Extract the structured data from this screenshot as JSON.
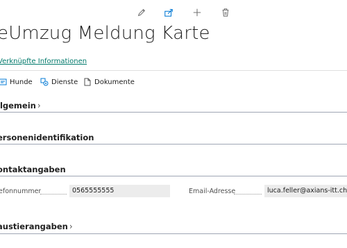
{
  "toolbar": {
    "edit_icon": "pencil-icon",
    "share_icon": "share-icon",
    "new_icon": "plus-icon",
    "delete_icon": "trash-icon"
  },
  "page": {
    "title": "eUmzug Meldung Karte",
    "related_link": "Verknüpfte Informationen"
  },
  "actions": [
    {
      "label": "Hunde",
      "icon": "dog-list-icon"
    },
    {
      "label": "Dienste",
      "icon": "services-icon"
    },
    {
      "label": "Dokumente",
      "icon": "document-icon"
    }
  ],
  "sections": {
    "allgemein": "llgemein",
    "personen": "ersonenidentifikation",
    "kontakt": "ontaktangaben",
    "haustier": "austierangaben"
  },
  "contact": {
    "phone_label": "efonnummer",
    "phone_value": "0565555555",
    "email_label": "Email-Adresse",
    "email_value": "luca.feller@axians-itt.ch"
  },
  "colors": {
    "link": "#00796b",
    "icon_accent": "#0078d4",
    "section_line": "#9fa6b4",
    "field_bg": "#ececec"
  }
}
